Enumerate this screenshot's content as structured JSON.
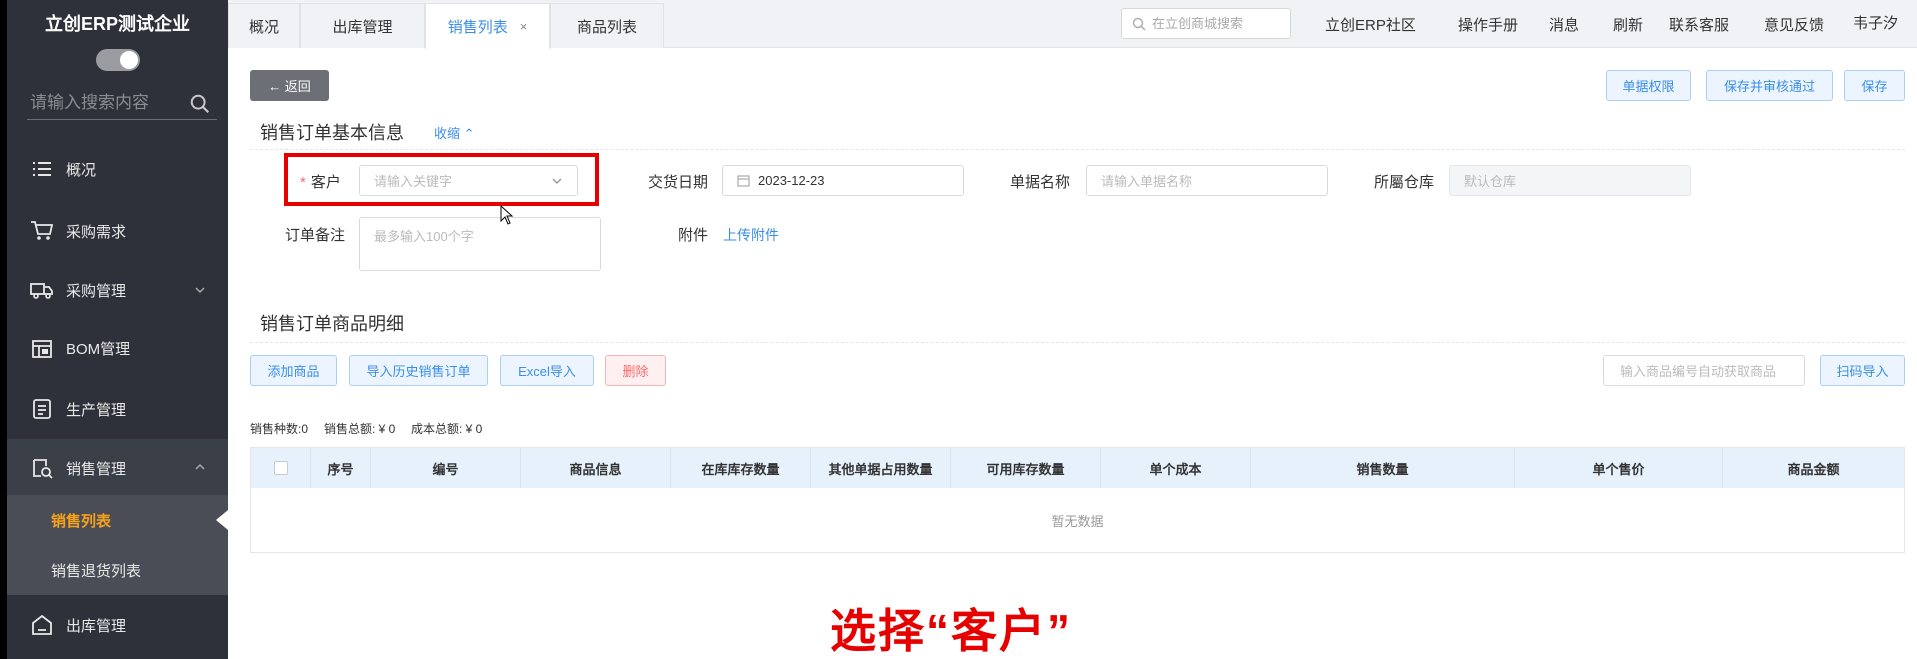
{
  "sidebar": {
    "brand": "立创ERP测试企业",
    "search_placeholder": "请输入搜索内容",
    "items": [
      {
        "label": "概况",
        "icon": "list-icon"
      },
      {
        "label": "采购需求",
        "icon": "cart-icon"
      },
      {
        "label": "采购管理",
        "icon": "truck-icon"
      },
      {
        "label": "BOM管理",
        "icon": "bom-icon"
      },
      {
        "label": "生产管理",
        "icon": "production-icon"
      },
      {
        "label": "销售管理",
        "icon": "sales-icon"
      },
      {
        "label": "出库管理",
        "icon": "outbound-icon"
      }
    ],
    "sub_items": [
      {
        "label": "销售列表",
        "active": true
      },
      {
        "label": "销售退货列表",
        "active": false
      }
    ]
  },
  "topbar": {
    "tabs": [
      {
        "label": "概况"
      },
      {
        "label": "出库管理"
      },
      {
        "label": "销售列表",
        "active": true,
        "close": "×"
      },
      {
        "label": "商品列表"
      }
    ],
    "search_placeholder": "在立创商城搜索",
    "links": [
      "立创ERP社区",
      "操作手册",
      "消息",
      "刷新",
      "联系客服",
      "意见反馈",
      "韦子汐"
    ]
  },
  "actions": {
    "back": "← 返回",
    "permission": "单据权限",
    "save_approve": "保存并审核通过",
    "save": "保存"
  },
  "basic_info": {
    "title": "销售订单基本信息",
    "collapse": "收缩 ⌃",
    "customer_label": "客户",
    "customer_placeholder": "请输入关键字",
    "delivery_date_label": "交货日期",
    "delivery_date": "2023-12-23",
    "doc_name_label": "单据名称",
    "doc_name_placeholder": "请输入单据名称",
    "warehouse_label": "所屬仓库",
    "warehouse_placeholder": "默认仓库",
    "remark_label": "订单备注",
    "remark_placeholder": "最多输入100个字",
    "attachment_label": "附件",
    "upload": "上传附件"
  },
  "detail": {
    "title": "销售订单商品明细",
    "buttons": {
      "add": "添加商品",
      "import_history": "导入历史销售订单",
      "excel": "Excel导入",
      "delete": "删除",
      "scan": "扫码导入"
    },
    "scan_placeholder": "输入商品编号自动获取商品",
    "summary": {
      "kinds": "销售种数:0",
      "total": "销售总额: ¥ 0",
      "cost": "成本总额: ¥ 0"
    },
    "columns": [
      "序号",
      "编号",
      "商品信息",
      "在库库存数量",
      "其他单据占用数量",
      "可用库存数量",
      "单个成本",
      "销售数量",
      "单个售价",
      "商品金额"
    ],
    "empty_text": "暂无数据"
  },
  "caption": "选择“客户”",
  "colors": {
    "accent": "#3a8ee6",
    "sidebar_bg": "#2e3139",
    "active_menu": "#f7a21b",
    "highlight": "#e60000"
  }
}
